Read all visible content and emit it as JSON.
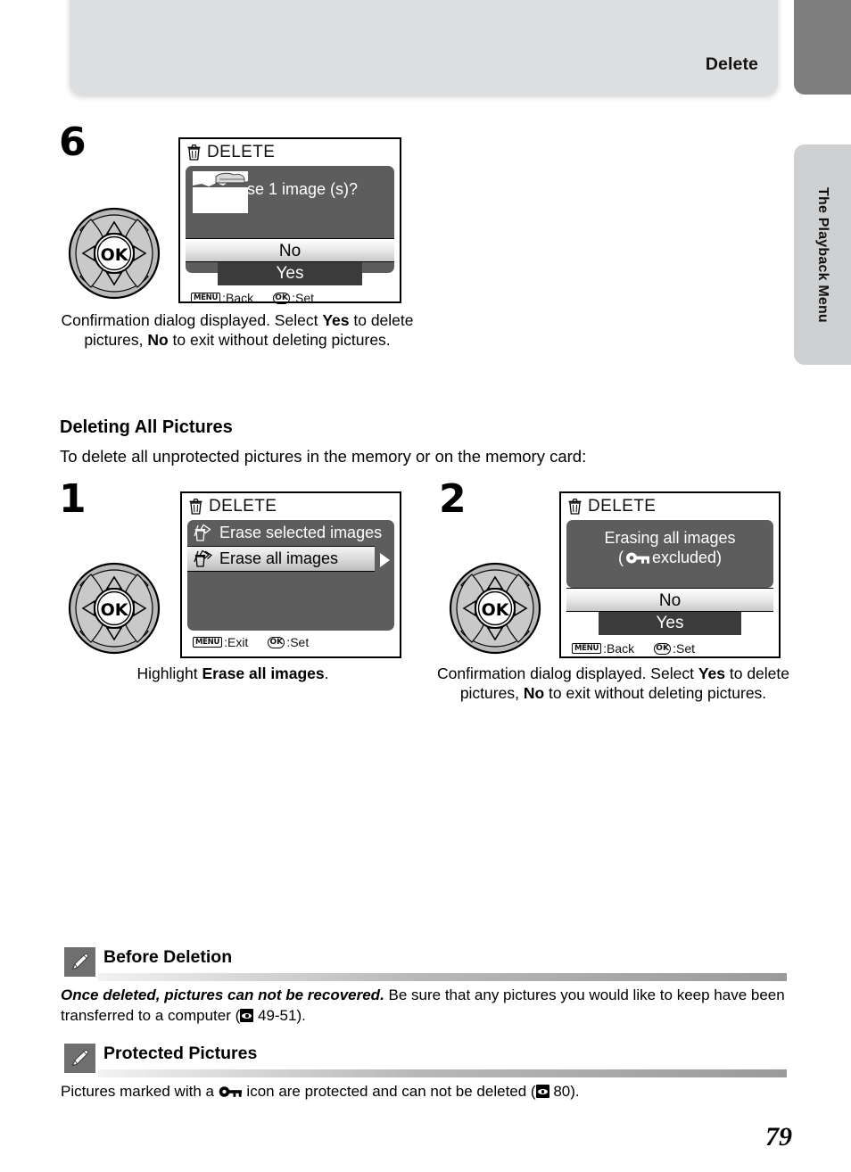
{
  "header": {
    "title": "Delete",
    "side_tab_label": "The Playback Menu"
  },
  "steps": [
    {
      "number": "6",
      "lcd": {
        "title": "DELETE",
        "title_icon": "trash-icon",
        "message": "Erase 1 image (s)?",
        "option_no": "No",
        "option_yes": "Yes",
        "foot_left_key": "MENU",
        "foot_left_label": ":Back",
        "foot_right_key": "OK",
        "foot_right_label": ":Set"
      },
      "caption_parts": [
        {
          "t": "Confirmation dialog displayed. Select ",
          "b": false
        },
        {
          "t": "Yes",
          "b": true
        },
        {
          "t": " to delete pictures, ",
          "b": false
        },
        {
          "t": "No",
          "b": true
        },
        {
          "t": " to exit without deleting pictures.",
          "b": false
        }
      ]
    },
    {
      "number": "1",
      "lcd": {
        "title": "DELETE",
        "title_icon": "trash-icon",
        "items": [
          {
            "label": "Erase selected images",
            "icon": "erase-selected-icon",
            "selected": false
          },
          {
            "label": "Erase all images",
            "icon": "erase-all-icon",
            "selected": true
          }
        ],
        "foot_left_key": "MENU",
        "foot_left_label": ":Exit",
        "foot_right_key": "OK",
        "foot_right_label": ":Set"
      },
      "caption_parts": [
        {
          "t": "Highlight ",
          "b": false
        },
        {
          "t": "Erase all images",
          "b": true
        },
        {
          "t": ".",
          "b": false
        }
      ]
    },
    {
      "number": "2",
      "lcd": {
        "title": "DELETE",
        "title_icon": "trash-icon",
        "message_line1": "Erasing all images",
        "message_line2_prefix": "(",
        "message_line2_icon": "key-icon",
        "message_line2_suffix": "excluded)",
        "option_no": "No",
        "option_yes": "Yes",
        "foot_left_key": "MENU",
        "foot_left_label": ":Back",
        "foot_right_key": "OK",
        "foot_right_label": ":Set"
      },
      "caption_parts": [
        {
          "t": "Confirmation dialog displayed. Select ",
          "b": false
        },
        {
          "t": "Yes",
          "b": true
        },
        {
          "t": " to delete pictures, ",
          "b": false
        },
        {
          "t": "No",
          "b": true
        },
        {
          "t": " to exit without deleting pictures.",
          "b": false
        }
      ]
    }
  ],
  "section": {
    "heading": "Deleting All Pictures",
    "subtext": "To delete all unprotected pictures in the memory or on the memory card:"
  },
  "notes": [
    {
      "icon": "pencil-note-icon",
      "title": "Before Deletion",
      "body_parts": [
        {
          "t": "Once deleted, pictures can not be recovered.",
          "i": true
        },
        {
          "t": " Be sure that any pictures you would like to keep have been transferred to a computer (",
          "i": false
        },
        {
          "t": "REF",
          "ref": true
        },
        {
          "t": " 49-51).",
          "i": false
        }
      ]
    },
    {
      "icon": "pencil-note-icon",
      "title": "Protected Pictures",
      "body_parts": [
        {
          "t": "Pictures marked with a ",
          "i": false
        },
        {
          "t": "KEY",
          "key": true
        },
        {
          "t": " icon are protected and can not be deleted (",
          "i": false
        },
        {
          "t": "REF",
          "ref": true
        },
        {
          "t": " 80).",
          "i": false
        }
      ]
    }
  ],
  "page_number": "79",
  "colors": {
    "header_bg": "#dddedf",
    "corner_tab": "#7e7e7e",
    "side_tab": "#cfd0d1",
    "lcd_bg": "#5d5d5d",
    "note_icon_bg": "#6f6f6f"
  }
}
